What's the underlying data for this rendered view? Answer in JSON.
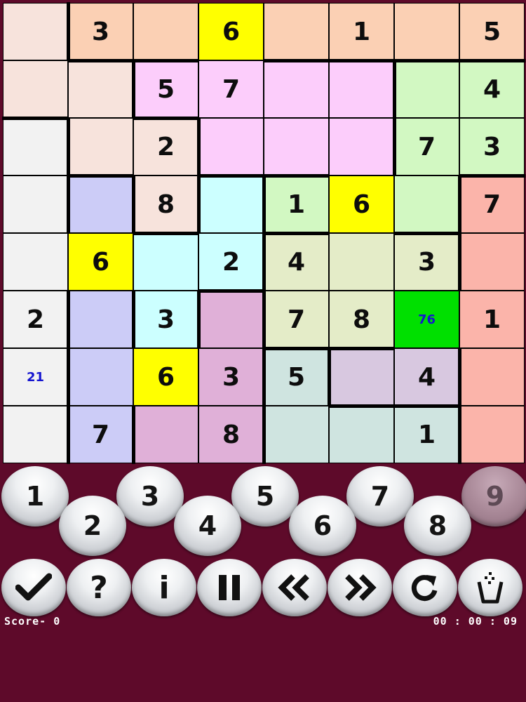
{
  "grid": {
    "rows": [
      [
        {
          "v": "",
          "bg": "#f7e3dc"
        },
        {
          "v": "3",
          "bg": "#fbd0b4"
        },
        {
          "v": "",
          "bg": "#fbd0b4"
        },
        {
          "v": "6",
          "bg": "#ffff00"
        },
        {
          "v": "",
          "bg": "#fbd0b4"
        },
        {
          "v": "1",
          "bg": "#fbd0b4"
        },
        {
          "v": "",
          "bg": "#fbd0b4"
        },
        {
          "v": "5",
          "bg": "#fbd0b4"
        }
      ],
      [
        {
          "v": "",
          "bg": "#f7e3dc"
        },
        {
          "v": "",
          "bg": "#f7e3dc"
        },
        {
          "v": "5",
          "bg": "#fccdfb"
        },
        {
          "v": "7",
          "bg": "#fccdfb"
        },
        {
          "v": "",
          "bg": "#fccdfb"
        },
        {
          "v": "",
          "bg": "#fccdfb"
        },
        {
          "v": "",
          "bg": "#d2f8c2"
        },
        {
          "v": "4",
          "bg": "#d2f8c2"
        }
      ],
      [
        {
          "v": "",
          "bg": "#f2f2f2"
        },
        {
          "v": "",
          "bg": "#f7e3dc"
        },
        {
          "v": "2",
          "bg": "#f7e3dc"
        },
        {
          "v": "",
          "bg": "#fccdfb"
        },
        {
          "v": "",
          "bg": "#fccdfb"
        },
        {
          "v": "",
          "bg": "#fccdfb"
        },
        {
          "v": "7",
          "bg": "#d2f8c2"
        },
        {
          "v": "3",
          "bg": "#d2f8c2"
        }
      ],
      [
        {
          "v": "",
          "bg": "#f2f2f2"
        },
        {
          "v": "",
          "bg": "#ccccf7"
        },
        {
          "v": "8",
          "bg": "#f7e3dc"
        },
        {
          "v": "",
          "bg": "#ccffff"
        },
        {
          "v": "1",
          "bg": "#d2f8c2"
        },
        {
          "v": "6",
          "bg": "#ffff00"
        },
        {
          "v": "",
          "bg": "#d2f8c2"
        },
        {
          "v": "7",
          "bg": "#fbb4aa"
        }
      ],
      [
        {
          "v": "",
          "bg": "#f2f2f2"
        },
        {
          "v": "6",
          "bg": "#ffff00"
        },
        {
          "v": "",
          "bg": "#ccffff"
        },
        {
          "v": "2",
          "bg": "#ccffff"
        },
        {
          "v": "4",
          "bg": "#e4ecc8"
        },
        {
          "v": "",
          "bg": "#e4ecc8"
        },
        {
          "v": "3",
          "bg": "#e4ecc8"
        },
        {
          "v": "",
          "bg": "#fbb4aa"
        }
      ],
      [
        {
          "v": "2",
          "bg": "#f2f2f2"
        },
        {
          "v": "",
          "bg": "#ccccf7"
        },
        {
          "v": "3",
          "bg": "#ccffff"
        },
        {
          "v": "",
          "bg": "#e0b0d8"
        },
        {
          "v": "7",
          "bg": "#e4ecc8"
        },
        {
          "v": "8",
          "bg": "#e4ecc8"
        },
        {
          "v": "76",
          "bg": "#00e000",
          "note": true
        },
        {
          "v": "1",
          "bg": "#fbb4aa"
        }
      ],
      [
        {
          "v": "21",
          "bg": "#f2f2f2",
          "note": true
        },
        {
          "v": "",
          "bg": "#ccccf7"
        },
        {
          "v": "6",
          "bg": "#ffff00"
        },
        {
          "v": "3",
          "bg": "#e0b0d8"
        },
        {
          "v": "5",
          "bg": "#cfe4e0"
        },
        {
          "v": "",
          "bg": "#d8c8e0"
        },
        {
          "v": "4",
          "bg": "#d8c8e0"
        },
        {
          "v": "",
          "bg": "#fbb4aa"
        }
      ],
      [
        {
          "v": "",
          "bg": "#f2f2f2"
        },
        {
          "v": "7",
          "bg": "#ccccf7"
        },
        {
          "v": "",
          "bg": "#e0b0d8"
        },
        {
          "v": "8",
          "bg": "#e0b0d8"
        },
        {
          "v": "",
          "bg": "#cfe4e0"
        },
        {
          "v": "",
          "bg": "#cfe4e0"
        },
        {
          "v": "1",
          "bg": "#cfe4e0"
        },
        {
          "v": "",
          "bg": "#fbb4aa"
        }
      ]
    ]
  },
  "number_buttons": [
    {
      "label": "1",
      "enabled": true
    },
    {
      "label": "2",
      "enabled": true
    },
    {
      "label": "3",
      "enabled": true
    },
    {
      "label": "4",
      "enabled": true
    },
    {
      "label": "5",
      "enabled": true
    },
    {
      "label": "6",
      "enabled": true
    },
    {
      "label": "7",
      "enabled": true
    },
    {
      "label": "8",
      "enabled": true
    },
    {
      "label": "9",
      "enabled": false
    }
  ],
  "tools": [
    {
      "name": "check-icon"
    },
    {
      "name": "help-icon",
      "label": "?"
    },
    {
      "name": "info-icon",
      "label": "i"
    },
    {
      "name": "pause-icon"
    },
    {
      "name": "rewind-icon"
    },
    {
      "name": "fast-forward-icon"
    },
    {
      "name": "redo-icon"
    },
    {
      "name": "trash-icon"
    }
  ],
  "status": {
    "score_label": "Score-",
    "score_value": "0",
    "timer": "00 : 00 : 09"
  },
  "colors": {
    "background": "#5e0a2a",
    "note_text": "#1515d0",
    "wall": "#000000"
  }
}
